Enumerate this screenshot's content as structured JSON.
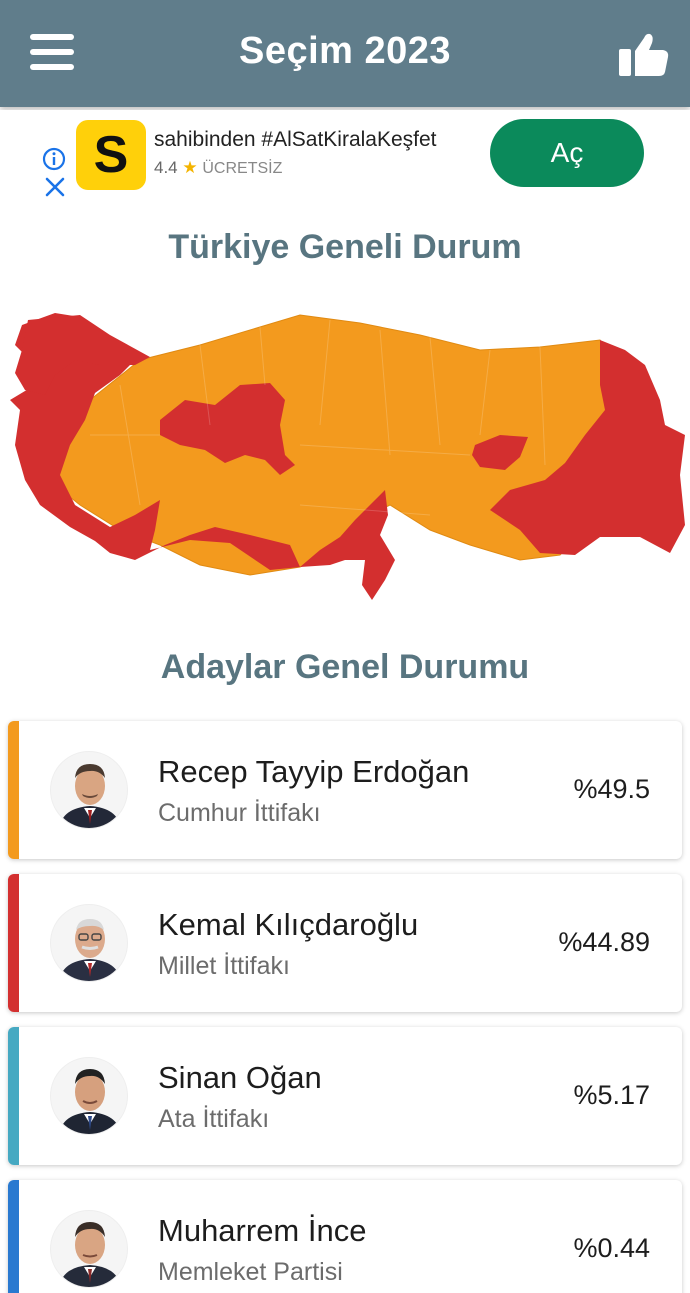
{
  "appbar": {
    "title": "Seçim 2023",
    "menu_icon": "hamburger-menu-icon",
    "like_icon": "thumbs-up-icon"
  },
  "ad": {
    "logo_letter": "S",
    "app_name": "sahibinden #AlSatKiralaKeşfet",
    "rating": "4.4",
    "star": "★",
    "price_label": "ÜCRETSİZ",
    "open_button": "Aç"
  },
  "map_section": {
    "title": "Türkiye Geneli Durum"
  },
  "candidates_section": {
    "title": "Adaylar Genel Durumu",
    "candidates": [
      {
        "name": "Recep Tayyip Erdoğan",
        "party": "Cumhur İttifakı",
        "percent": "%49.5",
        "color": "#f39a1e"
      },
      {
        "name": "Kemal Kılıçdaroğlu",
        "party": "Millet İttifakı",
        "percent": "%44.89",
        "color": "#d32f2f"
      },
      {
        "name": "Sinan Oğan",
        "party": "Ata İttifakı",
        "percent": "%5.17",
        "color": "#46a9c2"
      },
      {
        "name": "Muharrem İnce",
        "party": "Memleket Partisi",
        "percent": "%0.44",
        "color": "#2979d0"
      }
    ]
  },
  "colors": {
    "appbar": "#607d8b",
    "section_title": "#587580",
    "map_orange": "#f39a1e",
    "map_red": "#d32f2f",
    "ad_button": "#0b8a5b",
    "ad_logo": "#ffd00a"
  }
}
